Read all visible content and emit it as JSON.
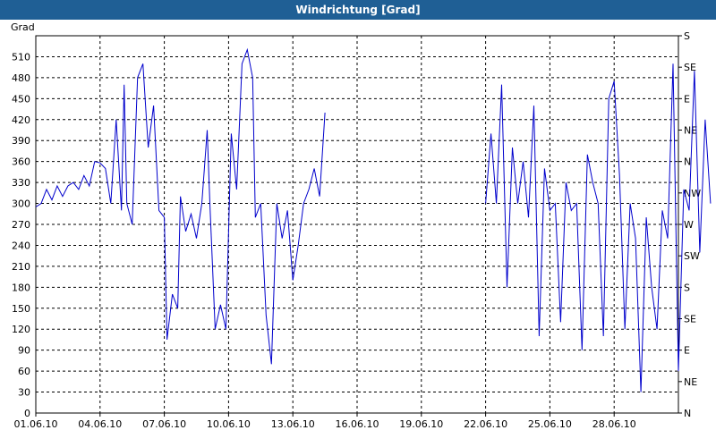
{
  "window": {
    "title": "Windrichtung [Grad]"
  },
  "colors": {
    "titlebar": "#1f5f95",
    "series": "#0000cc",
    "grid": "#000000"
  },
  "chart_data": {
    "type": "line",
    "title": "Windrichtung [Grad]",
    "ylabel": "Grad",
    "xlabel": "",
    "ylim": [
      0,
      540
    ],
    "xlim": [
      "2010-06-01",
      "2010-07-01"
    ],
    "grid": true,
    "yticks": [
      0,
      30,
      60,
      90,
      120,
      150,
      180,
      210,
      240,
      270,
      300,
      330,
      360,
      390,
      420,
      450,
      480,
      510
    ],
    "xticks": [
      "01.06.10",
      "04.06.10",
      "07.06.10",
      "10.06.10",
      "13.06.10",
      "16.06.10",
      "19.06.10",
      "22.06.10",
      "25.06.10",
      "28.06.10"
    ],
    "y2ticks": [
      {
        "value": 0,
        "label": "N"
      },
      {
        "value": 45,
        "label": "NE"
      },
      {
        "value": 90,
        "label": "E"
      },
      {
        "value": 135,
        "label": "SE"
      },
      {
        "value": 180,
        "label": "S"
      },
      {
        "value": 225,
        "label": "SW"
      },
      {
        "value": 270,
        "label": "W"
      },
      {
        "value": 315,
        "label": "NW"
      },
      {
        "value": 360,
        "label": "N"
      },
      {
        "value": 405,
        "label": "NE"
      },
      {
        "value": 450,
        "label": "E"
      },
      {
        "value": 495,
        "label": "SE"
      },
      {
        "value": 540,
        "label": "S"
      }
    ],
    "series": [
      {
        "segments": [
          [
            [
              "01.06.10 00:00",
              295
            ],
            [
              "01.06.10 06:00",
              300
            ],
            [
              "01.06.10 12:00",
              320
            ],
            [
              "01.06.10 18:00",
              305
            ],
            [
              "02.06.10 00:00",
              325
            ],
            [
              "02.06.10 06:00",
              310
            ],
            [
              "02.06.10 12:00",
              325
            ],
            [
              "02.06.10 18:00",
              330
            ],
            [
              "03.06.10 00:00",
              320
            ],
            [
              "03.06.10 06:00",
              340
            ],
            [
              "03.06.10 12:00",
              325
            ],
            [
              "03.06.10 18:00",
              360
            ],
            [
              "04.06.10 00:00",
              358
            ],
            [
              "04.06.10 06:00",
              350
            ],
            [
              "04.06.10 12:00",
              300
            ],
            [
              "04.06.10 18:00",
              420
            ],
            [
              "05.06.10 00:00",
              290
            ],
            [
              "05.06.10 03:00",
              470
            ],
            [
              "05.06.10 06:00",
              300
            ],
            [
              "05.06.10 12:00",
              270
            ],
            [
              "05.06.10 18:00",
              480
            ],
            [
              "06.06.10 00:00",
              500
            ],
            [
              "06.06.10 06:00",
              380
            ],
            [
              "06.06.10 12:00",
              440
            ],
            [
              "06.06.10 18:00",
              290
            ],
            [
              "07.06.10 00:00",
              280
            ],
            [
              "07.06.10 03:00",
              105
            ],
            [
              "07.06.10 09:00",
              170
            ],
            [
              "07.06.10 15:00",
              150
            ],
            [
              "07.06.10 18:00",
              310
            ],
            [
              "08.06.10 00:00",
              260
            ],
            [
              "08.06.10 06:00",
              285
            ],
            [
              "08.06.10 12:00",
              250
            ],
            [
              "08.06.10 18:00",
              300
            ],
            [
              "09.06.10 00:00",
              405
            ],
            [
              "09.06.10 03:00",
              300
            ],
            [
              "09.06.10 09:00",
              120
            ],
            [
              "09.06.10 15:00",
              155
            ],
            [
              "09.06.10 21:00",
              120
            ],
            [
              "10.06.10 03:00",
              400
            ],
            [
              "10.06.10 09:00",
              320
            ],
            [
              "10.06.10 15:00",
              500
            ],
            [
              "10.06.10 21:00",
              520
            ],
            [
              "11.06.10 03:00",
              480
            ],
            [
              "11.06.10 06:00",
              280
            ],
            [
              "11.06.10 12:00",
              300
            ],
            [
              "11.06.10 18:00",
              140
            ],
            [
              "12.06.10 00:00",
              70
            ],
            [
              "12.06.10 06:00",
              300
            ],
            [
              "12.06.10 12:00",
              250
            ],
            [
              "12.06.10 18:00",
              290
            ],
            [
              "13.06.10 00:00",
              190
            ],
            [
              "13.06.10 06:00",
              240
            ],
            [
              "13.06.10 12:00",
              300
            ],
            [
              "13.06.10 18:00",
              320
            ],
            [
              "14.06.10 00:00",
              350
            ],
            [
              "14.06.10 06:00",
              310
            ],
            [
              "14.06.10 12:00",
              430
            ]
          ],
          [
            [
              "22.06.10 00:00",
              300
            ],
            [
              "22.06.10 06:00",
              400
            ],
            [
              "22.06.10 12:00",
              300
            ],
            [
              "22.06.10 18:00",
              470
            ],
            [
              "23.06.10 00:00",
              180
            ],
            [
              "23.06.10 06:00",
              380
            ],
            [
              "23.06.10 12:00",
              300
            ],
            [
              "23.06.10 18:00",
              360
            ],
            [
              "24.06.10 00:00",
              280
            ],
            [
              "24.06.10 06:00",
              440
            ],
            [
              "24.06.10 12:00",
              110
            ],
            [
              "24.06.10 18:00",
              350
            ],
            [
              "25.06.10 00:00",
              290
            ],
            [
              "25.06.10 06:00",
              300
            ],
            [
              "25.06.10 12:00",
              130
            ],
            [
              "25.06.10 18:00",
              330
            ],
            [
              "26.06.10 00:00",
              290
            ],
            [
              "26.06.10 06:00",
              300
            ],
            [
              "26.06.10 12:00",
              90
            ],
            [
              "26.06.10 18:00",
              370
            ],
            [
              "27.06.10 00:00",
              330
            ],
            [
              "27.06.10 06:00",
              300
            ],
            [
              "27.06.10 12:00",
              110
            ],
            [
              "27.06.10 18:00",
              450
            ],
            [
              "28.06.10 00:00",
              475
            ],
            [
              "28.06.10 06:00",
              340
            ],
            [
              "28.06.10 12:00",
              120
            ],
            [
              "28.06.10 18:00",
              300
            ],
            [
              "29.06.10 00:00",
              250
            ],
            [
              "29.06.10 06:00",
              30
            ],
            [
              "29.06.10 12:00",
              280
            ],
            [
              "29.06.10 18:00",
              180
            ],
            [
              "30.06.10 00:00",
              120
            ],
            [
              "30.06.10 06:00",
              290
            ],
            [
              "30.06.10 12:00",
              250
            ],
            [
              "30.06.10 18:00",
              500
            ],
            [
              "01.07.10 00:00",
              60
            ],
            [
              "01.07.10 06:00",
              320
            ],
            [
              "01.07.10 12:00",
              290
            ],
            [
              "01.07.10 18:00",
              490
            ],
            [
              "02.07.10 00:00",
              230
            ],
            [
              "02.07.10 06:00",
              420
            ],
            [
              "02.07.10 12:00",
              300
            ]
          ]
        ]
      }
    ]
  }
}
